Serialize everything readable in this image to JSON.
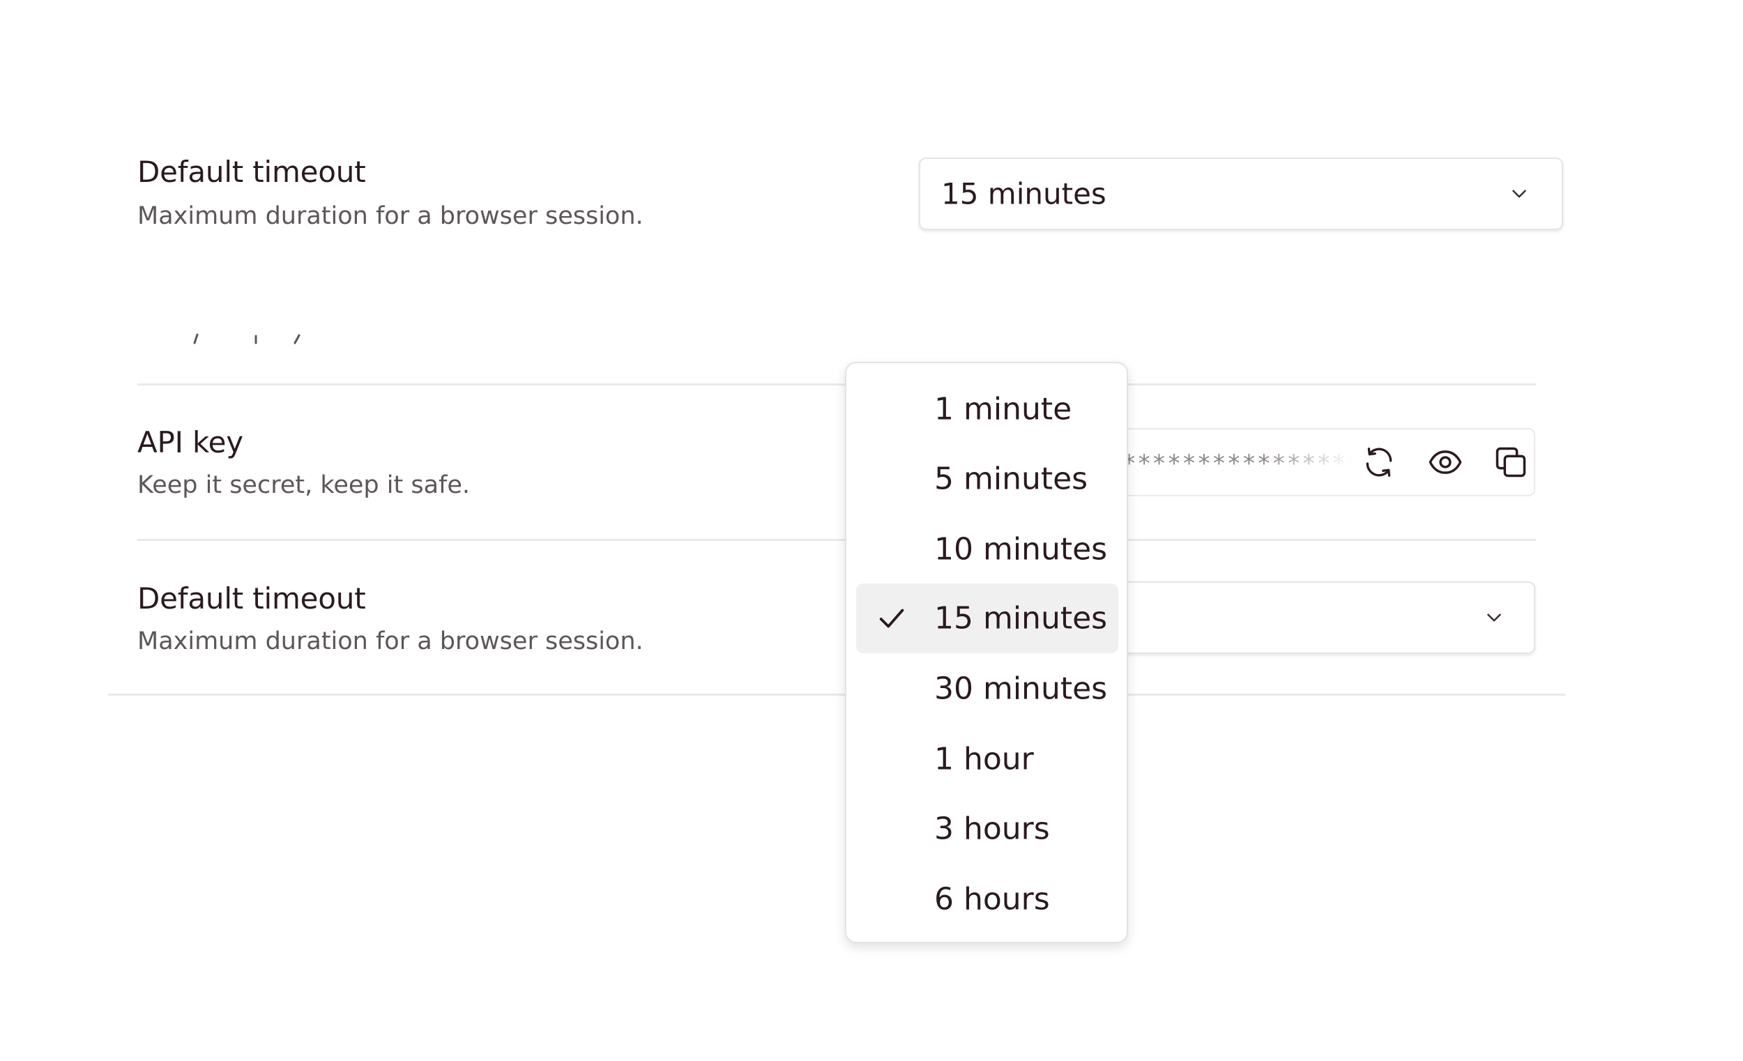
{
  "top_setting": {
    "title": "Default timeout",
    "description": "Maximum duration for a browser session.",
    "select_value": "15 minutes"
  },
  "api_key": {
    "title": "API key",
    "description": "Keep it secret, keep it safe.",
    "masked_value": "*************************************"
  },
  "timeout_setting": {
    "title": "Default timeout",
    "description": "Maximum duration for a browser session."
  },
  "dropdown": {
    "options": [
      {
        "label": "1 minute",
        "selected": false
      },
      {
        "label": "5 minutes",
        "selected": false
      },
      {
        "label": "10 minutes",
        "selected": false
      },
      {
        "label": "15 minutes",
        "selected": true
      },
      {
        "label": "30 minutes",
        "selected": false
      },
      {
        "label": "1 hour",
        "selected": false
      },
      {
        "label": "3 hours",
        "selected": false
      },
      {
        "label": "6 hours",
        "selected": false
      }
    ]
  },
  "icons": {
    "chevron": "chevron-down-icon",
    "regenerate": "refresh-icon",
    "reveal": "eye-icon",
    "copy": "copy-icon",
    "check": "check-icon"
  },
  "colors": {
    "text": "#2a1a1f",
    "muted": "#5c5659",
    "border": "#e7e3e4",
    "selected_bg": "#f1f0f0"
  }
}
